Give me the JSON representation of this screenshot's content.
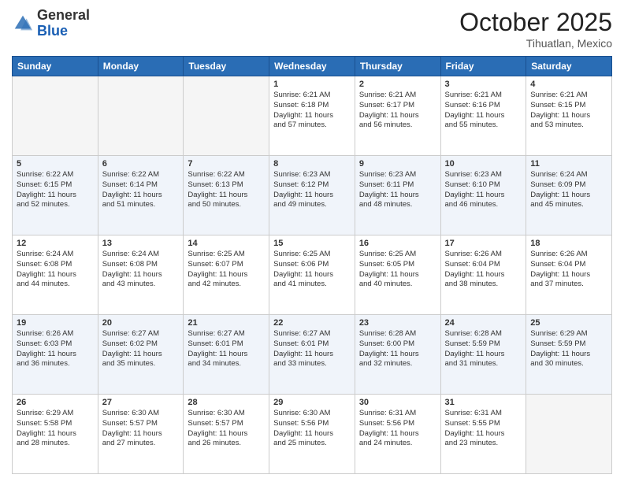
{
  "header": {
    "logo_general": "General",
    "logo_blue": "Blue",
    "month_title": "October 2025",
    "subtitle": "Tihuatlan, Mexico"
  },
  "days_of_week": [
    "Sunday",
    "Monday",
    "Tuesday",
    "Wednesday",
    "Thursday",
    "Friday",
    "Saturday"
  ],
  "weeks": [
    [
      {
        "day": "",
        "info": ""
      },
      {
        "day": "",
        "info": ""
      },
      {
        "day": "",
        "info": ""
      },
      {
        "day": "1",
        "info": "Sunrise: 6:21 AM\nSunset: 6:18 PM\nDaylight: 11 hours\nand 57 minutes."
      },
      {
        "day": "2",
        "info": "Sunrise: 6:21 AM\nSunset: 6:17 PM\nDaylight: 11 hours\nand 56 minutes."
      },
      {
        "day": "3",
        "info": "Sunrise: 6:21 AM\nSunset: 6:16 PM\nDaylight: 11 hours\nand 55 minutes."
      },
      {
        "day": "4",
        "info": "Sunrise: 6:21 AM\nSunset: 6:15 PM\nDaylight: 11 hours\nand 53 minutes."
      }
    ],
    [
      {
        "day": "5",
        "info": "Sunrise: 6:22 AM\nSunset: 6:15 PM\nDaylight: 11 hours\nand 52 minutes."
      },
      {
        "day": "6",
        "info": "Sunrise: 6:22 AM\nSunset: 6:14 PM\nDaylight: 11 hours\nand 51 minutes."
      },
      {
        "day": "7",
        "info": "Sunrise: 6:22 AM\nSunset: 6:13 PM\nDaylight: 11 hours\nand 50 minutes."
      },
      {
        "day": "8",
        "info": "Sunrise: 6:23 AM\nSunset: 6:12 PM\nDaylight: 11 hours\nand 49 minutes."
      },
      {
        "day": "9",
        "info": "Sunrise: 6:23 AM\nSunset: 6:11 PM\nDaylight: 11 hours\nand 48 minutes."
      },
      {
        "day": "10",
        "info": "Sunrise: 6:23 AM\nSunset: 6:10 PM\nDaylight: 11 hours\nand 46 minutes."
      },
      {
        "day": "11",
        "info": "Sunrise: 6:24 AM\nSunset: 6:09 PM\nDaylight: 11 hours\nand 45 minutes."
      }
    ],
    [
      {
        "day": "12",
        "info": "Sunrise: 6:24 AM\nSunset: 6:08 PM\nDaylight: 11 hours\nand 44 minutes."
      },
      {
        "day": "13",
        "info": "Sunrise: 6:24 AM\nSunset: 6:08 PM\nDaylight: 11 hours\nand 43 minutes."
      },
      {
        "day": "14",
        "info": "Sunrise: 6:25 AM\nSunset: 6:07 PM\nDaylight: 11 hours\nand 42 minutes."
      },
      {
        "day": "15",
        "info": "Sunrise: 6:25 AM\nSunset: 6:06 PM\nDaylight: 11 hours\nand 41 minutes."
      },
      {
        "day": "16",
        "info": "Sunrise: 6:25 AM\nSunset: 6:05 PM\nDaylight: 11 hours\nand 40 minutes."
      },
      {
        "day": "17",
        "info": "Sunrise: 6:26 AM\nSunset: 6:04 PM\nDaylight: 11 hours\nand 38 minutes."
      },
      {
        "day": "18",
        "info": "Sunrise: 6:26 AM\nSunset: 6:04 PM\nDaylight: 11 hours\nand 37 minutes."
      }
    ],
    [
      {
        "day": "19",
        "info": "Sunrise: 6:26 AM\nSunset: 6:03 PM\nDaylight: 11 hours\nand 36 minutes."
      },
      {
        "day": "20",
        "info": "Sunrise: 6:27 AM\nSunset: 6:02 PM\nDaylight: 11 hours\nand 35 minutes."
      },
      {
        "day": "21",
        "info": "Sunrise: 6:27 AM\nSunset: 6:01 PM\nDaylight: 11 hours\nand 34 minutes."
      },
      {
        "day": "22",
        "info": "Sunrise: 6:27 AM\nSunset: 6:01 PM\nDaylight: 11 hours\nand 33 minutes."
      },
      {
        "day": "23",
        "info": "Sunrise: 6:28 AM\nSunset: 6:00 PM\nDaylight: 11 hours\nand 32 minutes."
      },
      {
        "day": "24",
        "info": "Sunrise: 6:28 AM\nSunset: 5:59 PM\nDaylight: 11 hours\nand 31 minutes."
      },
      {
        "day": "25",
        "info": "Sunrise: 6:29 AM\nSunset: 5:59 PM\nDaylight: 11 hours\nand 30 minutes."
      }
    ],
    [
      {
        "day": "26",
        "info": "Sunrise: 6:29 AM\nSunset: 5:58 PM\nDaylight: 11 hours\nand 28 minutes."
      },
      {
        "day": "27",
        "info": "Sunrise: 6:30 AM\nSunset: 5:57 PM\nDaylight: 11 hours\nand 27 minutes."
      },
      {
        "day": "28",
        "info": "Sunrise: 6:30 AM\nSunset: 5:57 PM\nDaylight: 11 hours\nand 26 minutes."
      },
      {
        "day": "29",
        "info": "Sunrise: 6:30 AM\nSunset: 5:56 PM\nDaylight: 11 hours\nand 25 minutes."
      },
      {
        "day": "30",
        "info": "Sunrise: 6:31 AM\nSunset: 5:56 PM\nDaylight: 11 hours\nand 24 minutes."
      },
      {
        "day": "31",
        "info": "Sunrise: 6:31 AM\nSunset: 5:55 PM\nDaylight: 11 hours\nand 23 minutes."
      },
      {
        "day": "",
        "info": ""
      }
    ]
  ]
}
